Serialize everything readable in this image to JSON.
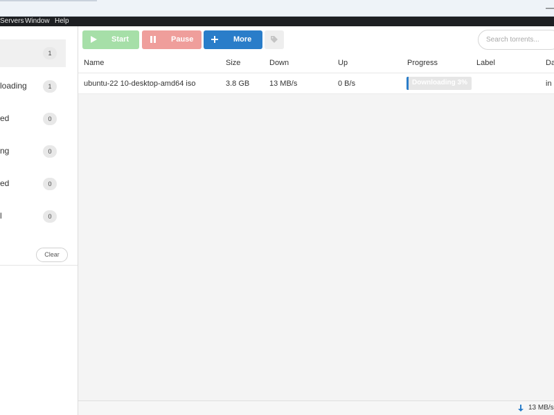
{
  "titlebar": {
    "minimize_glyph": "—"
  },
  "menu": [
    "Servers",
    "Window",
    "Help"
  ],
  "sidebar": {
    "items": [
      {
        "label": "",
        "count": "1"
      },
      {
        "label": "loading",
        "count": "1"
      },
      {
        "label": "ed",
        "count": "0"
      },
      {
        "label": "ng",
        "count": "0"
      },
      {
        "label": "ed",
        "count": "0"
      },
      {
        "label": "l",
        "count": "0"
      }
    ],
    "clear_label": "Clear"
  },
  "toolbar": {
    "start_label": "Start",
    "pause_label": "Pause",
    "more_label": "More",
    "search_placeholder": "Search torrents...",
    "icons": {
      "start": "play-icon",
      "pause": "pause-icon",
      "more": "plus-icon",
      "tag": "tag-icon"
    }
  },
  "table": {
    "columns": [
      "Name",
      "Size",
      "Down",
      "Up",
      "Progress",
      "Label",
      "Da"
    ],
    "rows": [
      {
        "name": "ubuntu-22 10-desktop-amd64 iso",
        "size": "3.8 GB",
        "down": "13 MB/s",
        "up": "0 B/s",
        "progress_text": "Downloading 3%",
        "progress_value": 3,
        "label": "",
        "date": "in a"
      }
    ]
  },
  "statusbar": {
    "down_speed": "13 MB/s"
  },
  "colors": {
    "accent": "#2a7dc9",
    "start": "#a6dfa8",
    "pause": "#ef9e9b",
    "menubar": "#1d1f22"
  }
}
